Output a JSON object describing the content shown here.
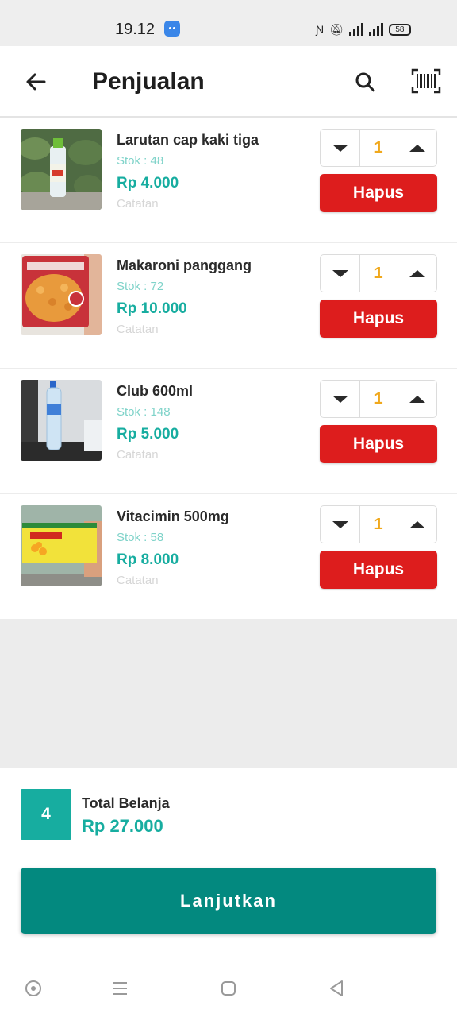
{
  "status_bar": {
    "time": "19.12",
    "battery": "58",
    "icons": [
      "app-notification-icon",
      "nfc-icon",
      "bell-muted-icon",
      "4g-signal-icon",
      "signal-icon",
      "battery-icon"
    ]
  },
  "app_bar": {
    "title": "Penjualan",
    "icons": [
      "back-arrow-icon",
      "search-icon",
      "barcode-scan-icon"
    ]
  },
  "items": [
    {
      "name": "Larutan cap kaki tiga",
      "stock": "Stok : 48",
      "price": "Rp 4.000",
      "note": "Catatan",
      "qty": "1",
      "delete_label": "Hapus"
    },
    {
      "name": "Makaroni panggang",
      "stock": "Stok : 72",
      "price": "Rp 10.000",
      "note": "Catatan",
      "qty": "1",
      "delete_label": "Hapus"
    },
    {
      "name": "Club 600ml",
      "stock": "Stok : 148",
      "price": "Rp 5.000",
      "note": "Catatan",
      "qty": "1",
      "delete_label": "Hapus"
    },
    {
      "name": "Vitacimin 500mg",
      "stock": "Stok : 58",
      "price": "Rp 8.000",
      "note": "Catatan",
      "qty": "1",
      "delete_label": "Hapus"
    }
  ],
  "footer": {
    "item_count": "4",
    "total_label": "Total Belanja",
    "total_value": "Rp 27.000",
    "continue_label": "Lanjutkan"
  },
  "colors": {
    "teal": "#17ada0",
    "teal_dark": "#03897f",
    "red": "#dd1d1d",
    "qty_yellow": "#f0a81c"
  },
  "system_nav": [
    "assistant-icon",
    "menu-icon",
    "home-icon",
    "back-icon"
  ]
}
